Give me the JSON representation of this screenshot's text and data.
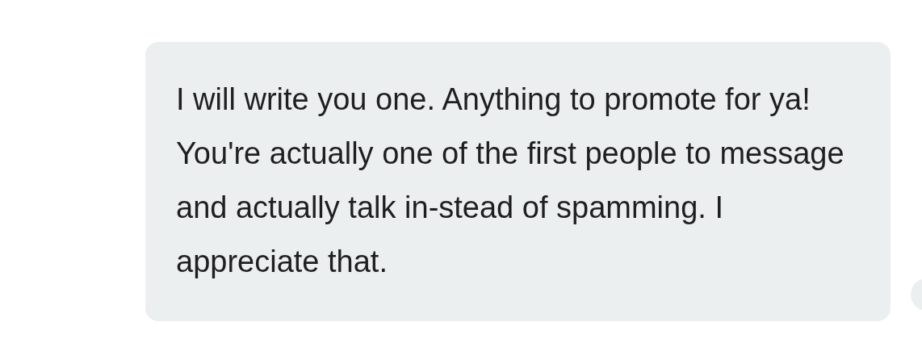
{
  "messages": [
    {
      "text": "I will write you one. Anything to promote for ya! You're actually one of the first people to message and actually talk in-stead of spamming. I appreciate that.",
      "outgoing": false
    }
  ]
}
